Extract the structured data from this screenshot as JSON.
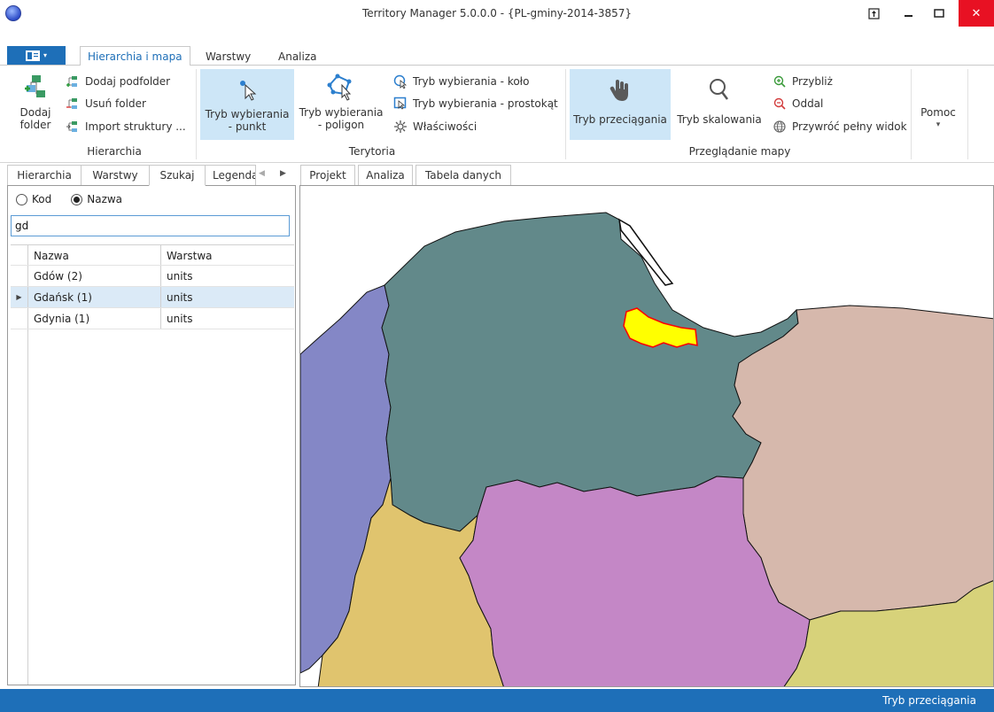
{
  "window": {
    "title": "Territory Manager 5.0.0.0 - {PL-gminy-2014-3857}",
    "close_glyph": "✕"
  },
  "ribbon_tabs": [
    {
      "label": "Hierarchia i mapa",
      "active": true
    },
    {
      "label": "Warstwy",
      "active": false
    },
    {
      "label": "Analiza",
      "active": false
    }
  ],
  "ribbon": {
    "hierarchia": {
      "group_label": "Hierarchia",
      "add_folder": "Dodaj\nfolder",
      "add_folder_l1": "Dodaj",
      "add_folder_l2": "folder",
      "add_subfolder": "Dodaj podfolder",
      "remove_folder": "Usuń folder",
      "import_structure": "Import struktury ..."
    },
    "terytoria": {
      "group_label": "Terytoria",
      "select_point_l1": "Tryb wybierania",
      "select_point_l2": "- punkt",
      "select_polygon_l1": "Tryb wybierania",
      "select_polygon_l2": "- poligon",
      "select_circle": "Tryb wybierania - koło",
      "select_rect": "Tryb wybierania - prostokąt",
      "properties": "Właściwości"
    },
    "przegladanie": {
      "group_label": "Przeglądanie mapy",
      "drag_mode": "Tryb przeciągania",
      "scale_mode": "Tryb skalowania",
      "zoom_in": "Przybliż",
      "zoom_out": "Oddal",
      "full_view": "Przywróć pełny widok"
    },
    "help": {
      "label": "Pomoc",
      "arrow": "▾"
    }
  },
  "left_panel": {
    "tabs": [
      "Hierarchia",
      "Warstwy",
      "Szukaj",
      "Legenda"
    ],
    "active_tab": "Szukaj",
    "radio_code": "Kod",
    "radio_name": "Nazwa",
    "selected_radio": "Nazwa",
    "search_value": "gd",
    "grid": {
      "columns": [
        "Nazwa",
        "Warstwa"
      ],
      "rows": [
        {
          "name": "Gdów (2)",
          "layer": "units",
          "selected": false
        },
        {
          "name": "Gdańsk (1)",
          "layer": "units",
          "selected": true
        },
        {
          "name": "Gdynia (1)",
          "layer": "units",
          "selected": false
        }
      ],
      "row_indicator": "▶"
    }
  },
  "map_tabs": [
    "Projekt",
    "Analiza",
    "Tabela danych"
  ],
  "map": {
    "colors": {
      "pomorskie": "#62898a",
      "west": "#8487c6",
      "east": "#d6b8ac",
      "south_left": "#e0c46e",
      "south_mid": "#c487c6",
      "south_right": "#d7d27a",
      "highlight_fill": "#ffff00",
      "highlight_stroke": "#ff0000"
    }
  },
  "statusbar": {
    "text": "Tryb przeciągania"
  },
  "colors": {
    "accent": "#1e6fb8",
    "selected": "#cde6f7"
  }
}
